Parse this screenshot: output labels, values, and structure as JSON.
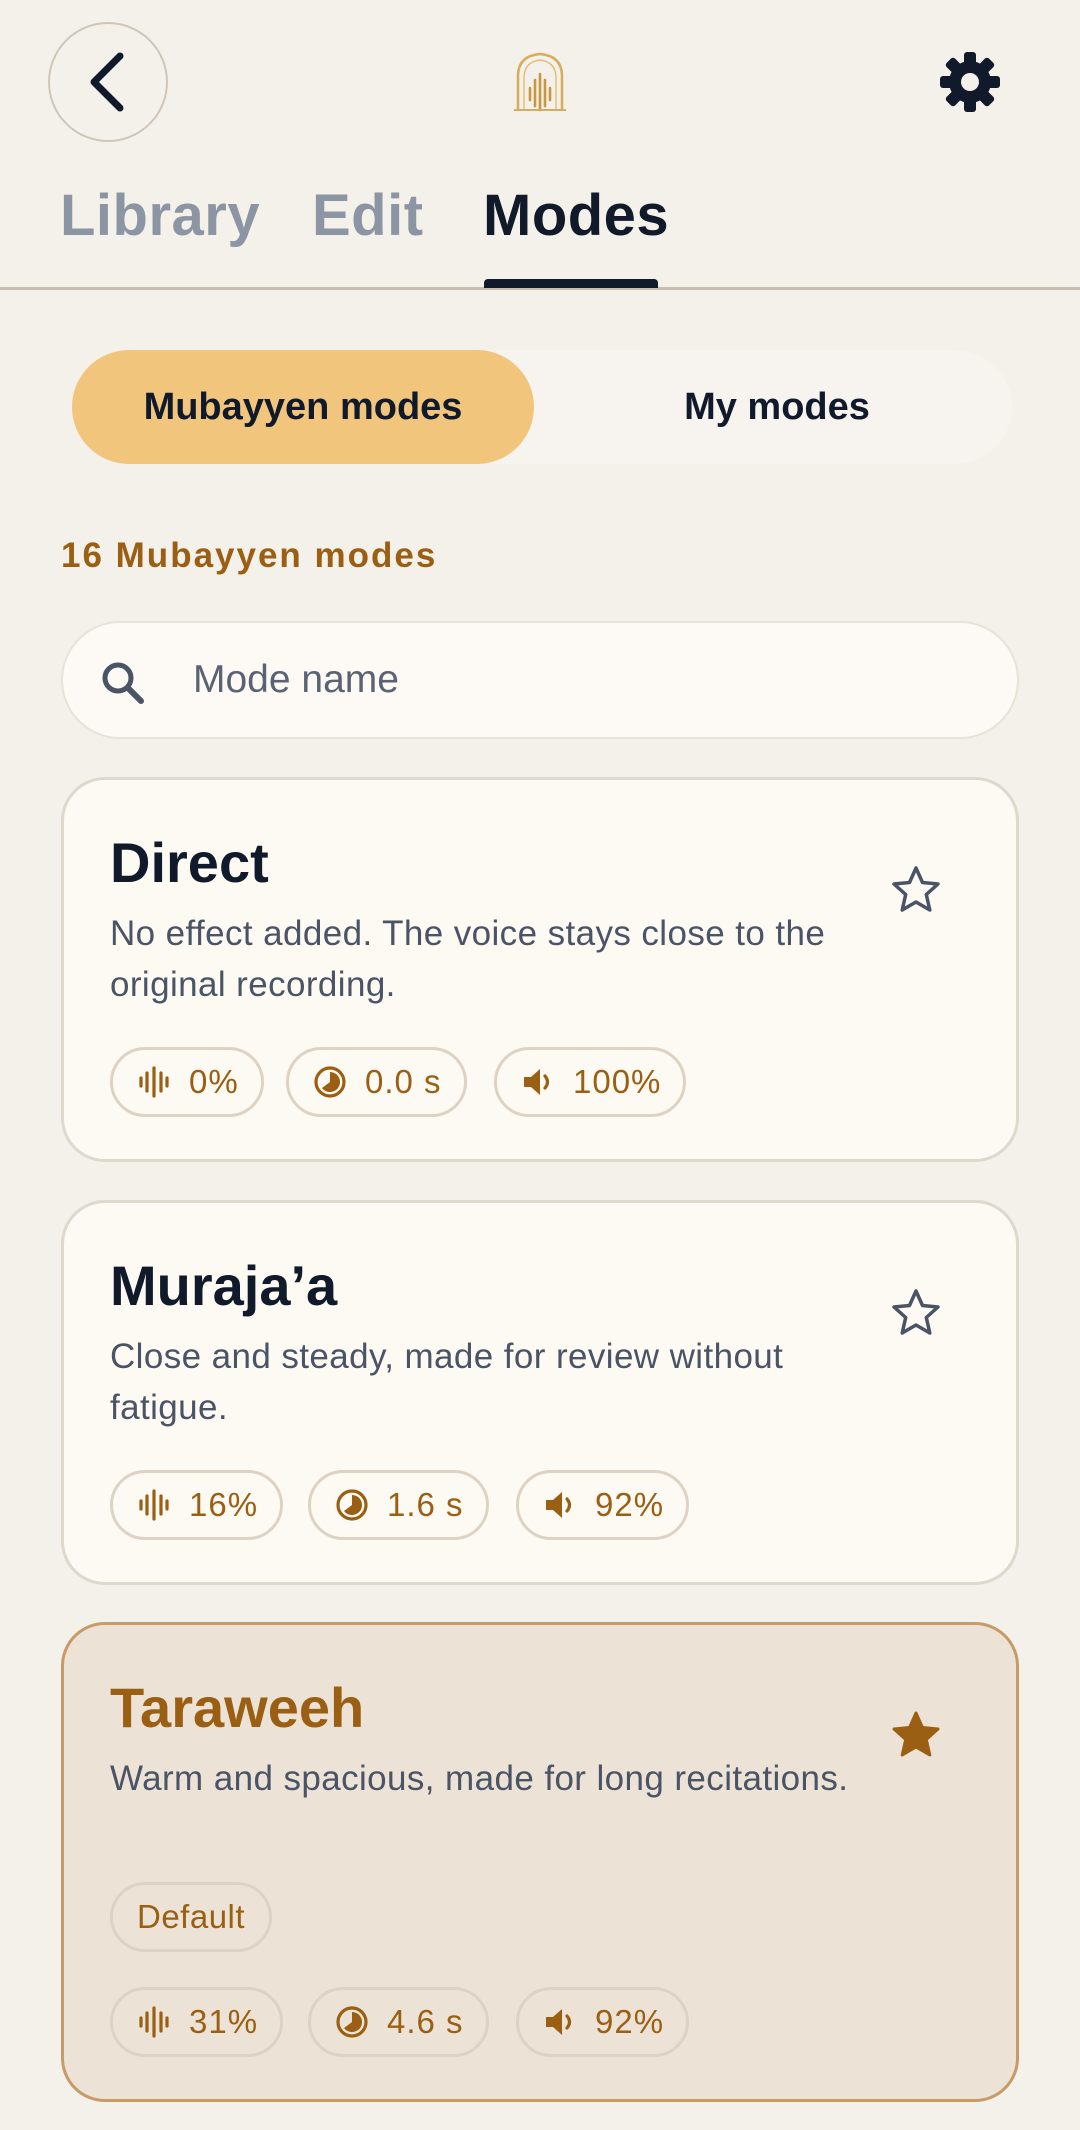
{
  "tabs": [
    {
      "label": "Library"
    },
    {
      "label": "Edit"
    },
    {
      "label": "Modes"
    }
  ],
  "segments": [
    {
      "label": "Mubayyen modes",
      "selected": true
    },
    {
      "label": "My modes",
      "selected": false
    }
  ],
  "count_label": "16 Mubayyen modes",
  "search": {
    "placeholder": "Mode name",
    "value": ""
  },
  "modes": [
    {
      "name": "Direct",
      "description": "No effect added. The voice stays close to the original recording.",
      "favorite": false,
      "reverb": "0%",
      "decay": "0.0 s",
      "volume": "100%"
    },
    {
      "name": "Muraja’a",
      "description": "Close and steady, made for review without fatigue.",
      "favorite": false,
      "reverb": "16%",
      "decay": "1.6 s",
      "volume": "92%"
    },
    {
      "name": "Taraweeh",
      "description": "Warm and spacious, made for long recitations.",
      "favorite": true,
      "badge": "Default",
      "reverb": "31%",
      "decay": "4.6 s",
      "volume": "92%"
    }
  ],
  "icons": {
    "back": "chevron-left-icon",
    "logo": "arch-waveform-logo",
    "settings": "gear-icon",
    "search": "search-icon",
    "favorite": "star-icon",
    "reverb": "waveform-icon",
    "decay": "timer-icon",
    "volume": "speaker-icon"
  },
  "colors": {
    "background": "#f4f0ea",
    "accent": "#f2c57c",
    "brown": "#9a5f12",
    "text": "#101a2b",
    "selected_card": "#ece3d6"
  }
}
